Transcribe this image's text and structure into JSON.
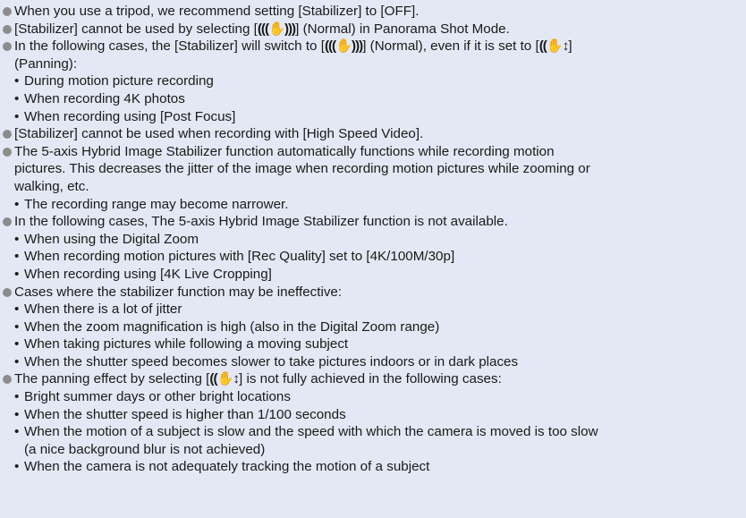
{
  "notes": [
    {
      "parts": [
        "When you use a tripod, we recommend setting [Stabilizer] to [OFF]."
      ]
    },
    {
      "parts": [
        "[Stabilizer] cannot be used by selecting [",
        "] (Normal) in Panorama Shot Mode."
      ],
      "icons": [
        "(((✋)))"
      ]
    },
    {
      "parts": [
        "In the following cases, the [Stabilizer] will switch to [",
        "] (Normal), even if it is set to [",
        "]",
        "(Panning):"
      ],
      "icons": [
        "(((✋)))",
        "((✋↕"
      ],
      "subs": [
        "During motion picture recording",
        "When recording 4K photos",
        "When recording using [Post Focus]"
      ]
    },
    {
      "parts": [
        "[Stabilizer] cannot be used when recording with [High Speed Video]."
      ]
    },
    {
      "parts": [
        "The 5-axis Hybrid Image Stabilizer function automatically functions while recording motion",
        "pictures. This decreases the jitter of the image when recording motion pictures while zooming or",
        "walking, etc."
      ],
      "subs": [
        "The recording range may become narrower."
      ]
    },
    {
      "parts": [
        "In the following cases, The 5-axis Hybrid Image Stabilizer function is not available."
      ],
      "subs": [
        "When using the Digital Zoom",
        "When recording motion pictures with [Rec Quality] set to [4K/100M/30p]",
        "When recording using [4K Live Cropping]"
      ]
    },
    {
      "parts": [
        "Cases where the stabilizer function may be ineffective:"
      ],
      "subs": [
        "When there is a lot of jitter",
        "When the zoom magnification is high (also in the Digital Zoom range)",
        "When taking pictures while following a moving subject",
        "When the shutter speed becomes slower to take pictures indoors or in dark places"
      ]
    },
    {
      "parts": [
        "The panning effect by selecting [",
        "] is not fully achieved in the following cases:"
      ],
      "icons": [
        "((✋↕"
      ],
      "subs": [
        "Bright summer days or other bright locations",
        "When the shutter speed is higher than 1/100 seconds",
        "When the motion of a subject is slow and the speed with which the camera is moved is too slow",
        "(a nice background blur is not achieved)",
        "When the camera is not adequately tracking the motion of a subject"
      ]
    }
  ],
  "sub_bullet": "•"
}
